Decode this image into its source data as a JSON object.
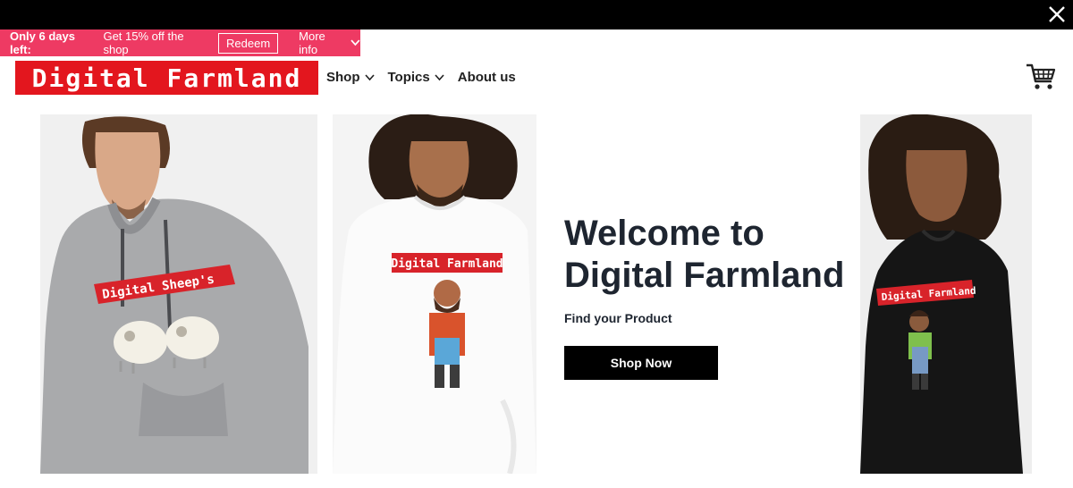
{
  "promo": {
    "bold": "Only 6 days left:",
    "text": "Get 15% off the shop",
    "redeem_label": "Redeem",
    "more_label": "More info"
  },
  "brand": {
    "logo_text": "Digital Farmland"
  },
  "nav": {
    "shop": "Shop",
    "topics": "Topics",
    "about": "About us"
  },
  "hero": {
    "title_line1": "Welcome to",
    "title_line2": "Digital Farmland",
    "subtitle": "Find your Product",
    "cta_label": "Shop Now"
  },
  "products": [
    {
      "shirt_text": "Digital Sheep's"
    },
    {
      "shirt_text": "Digital Farmland"
    },
    {
      "shirt_text": "Digital Farmland"
    }
  ],
  "colors": {
    "promo": "#ee3a63",
    "brand_red": "#e3161e",
    "dark": "#1e2530"
  },
  "icons": {
    "close": "close-icon",
    "cart": "cart-icon",
    "chevron": "chevron-down-icon"
  }
}
